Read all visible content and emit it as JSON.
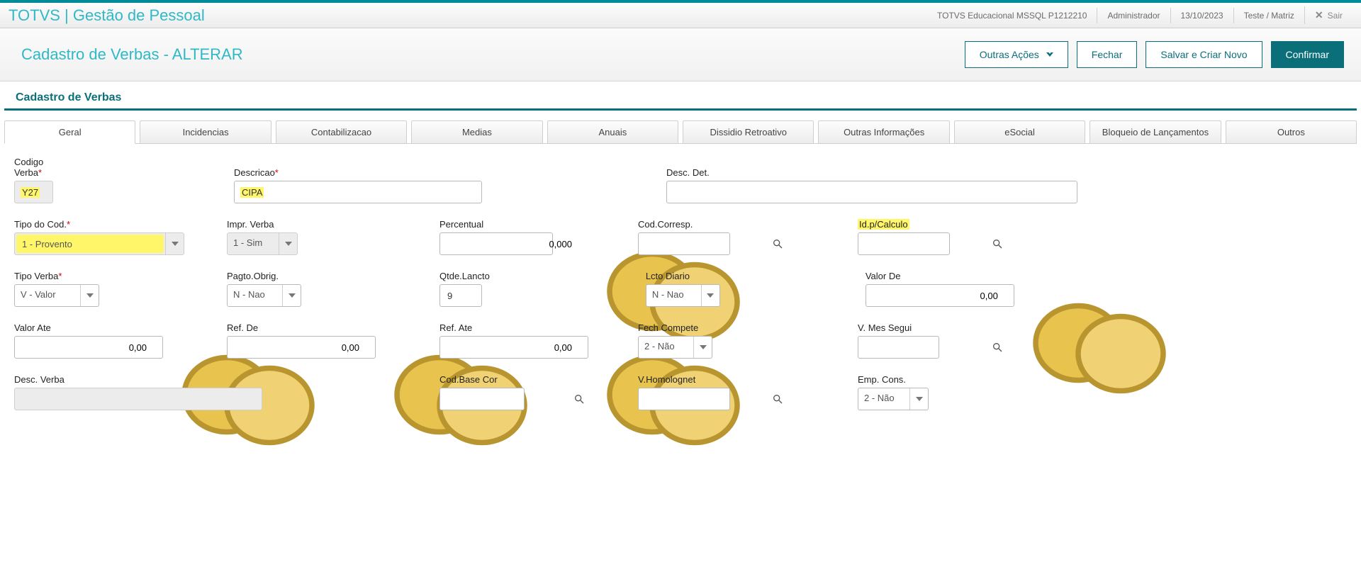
{
  "topbar": {
    "title": "TOTVS | Gestão de Pessoal",
    "env": "TOTVS Educacional MSSQL P1212210",
    "user": "Administrador",
    "date": "13/10/2023",
    "branch": "Teste / Matriz",
    "exit": "Sair"
  },
  "pagehead": {
    "title": "Cadastro de Verbas - ALTERAR",
    "other_actions": "Outras Ações",
    "close": "Fechar",
    "save_new": "Salvar e Criar Novo",
    "confirm": "Confirmar"
  },
  "section_title": "Cadastro de Verbas",
  "tabs": [
    "Geral",
    "Incidencias",
    "Contabilizacao",
    "Medias",
    "Anuais",
    "Dissidio Retroativo",
    "Outras Informações",
    "eSocial",
    "Bloqueio de Lançamentos",
    "Outros"
  ],
  "fields": {
    "codigo_verba": {
      "label": "Codigo Verba",
      "value": "Y27"
    },
    "descricao": {
      "label": "Descricao",
      "value": "CIPA"
    },
    "desc_det": {
      "label": "Desc. Det.",
      "value": ""
    },
    "tipo_cod": {
      "label": "Tipo do Cod.",
      "value": "1 - Provento"
    },
    "impr_verba": {
      "label": "Impr. Verba",
      "value": "1 - Sim"
    },
    "percentual": {
      "label": "Percentual",
      "value": "0,000"
    },
    "cod_corresp": {
      "label": "Cod.Corresp.",
      "value": ""
    },
    "id_calculo": {
      "label": "Id.p/Calculo",
      "value": ""
    },
    "tipo_verba": {
      "label": "Tipo Verba",
      "value": "V - Valor"
    },
    "pagto_obrig": {
      "label": "Pagto.Obrig.",
      "value": "N - Nao"
    },
    "qtde_lancto": {
      "label": "Qtde.Lancto",
      "value": "9"
    },
    "lcto_diario": {
      "label": "Lcto Diario",
      "value": "N - Nao"
    },
    "valor_de": {
      "label": "Valor De",
      "value": "0,00"
    },
    "valor_ate": {
      "label": "Valor Ate",
      "value": "0,00"
    },
    "ref_de": {
      "label": "Ref. De",
      "value": "0,00"
    },
    "ref_ate": {
      "label": "Ref. Ate",
      "value": "0,00"
    },
    "fech_compete": {
      "label": "Fech Compete",
      "value": "2 - Não"
    },
    "v_mes_segui": {
      "label": "V. Mes Segui",
      "value": ""
    },
    "desc_verba": {
      "label": "Desc. Verba",
      "value": ""
    },
    "cod_base_cor": {
      "label": "Cod.Base Cor",
      "value": ""
    },
    "v_homolognet": {
      "label": "V.Homolognet",
      "value": ""
    },
    "emp_cons": {
      "label": "Emp. Cons.",
      "value": "2 - Não"
    }
  }
}
